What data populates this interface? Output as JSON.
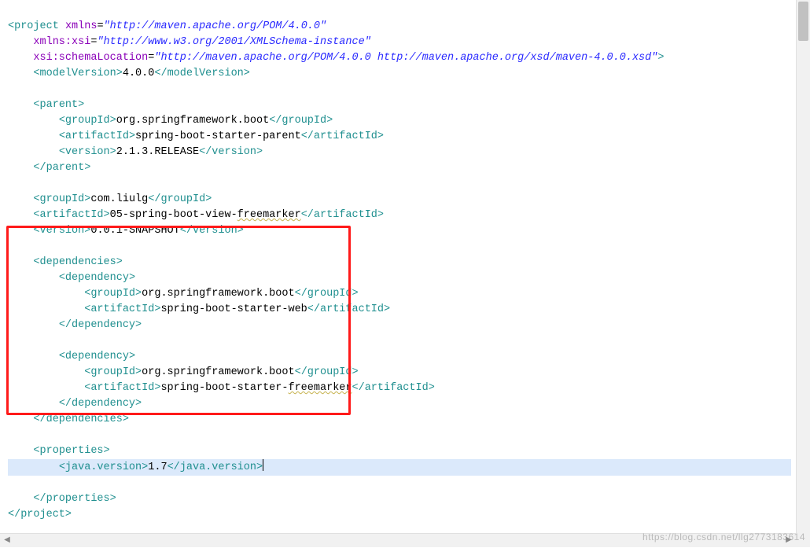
{
  "xml": {
    "project_open": "project",
    "project_close": "project",
    "xmlns_attr": "xmlns",
    "xmlns_val": "\"http://maven.apache.org/POM/4.0.0\"",
    "xmlns_xsi_attr": "xmlns:xsi",
    "xmlns_xsi_val": "\"http://www.w3.org/2001/XMLSchema-instance\"",
    "xsi_schema_attr": "xsi:schemaLocation",
    "xsi_schema_val": "\"http://maven.apache.org/POM/4.0.0 http://maven.apache.org/xsd/maven-4.0.0.xsd\"",
    "modelVersion_tag": "modelVersion",
    "modelVersion_val": "4.0.0",
    "parent_tag": "parent",
    "groupId_tag": "groupId",
    "artifactId_tag": "artifactId",
    "version_tag": "version",
    "parent_groupId": "org.springframework.boot",
    "parent_artifactId": "spring-boot-starter-parent",
    "parent_version": "2.1.3.RELEASE",
    "proj_groupId": "com.liulg",
    "proj_artifactId_pre": "05-spring-boot-view-",
    "proj_artifactId_sq": "freemarker",
    "proj_version": "0.0.1-SNAPSHOT",
    "dependencies_tag": "dependencies",
    "dependency_tag": "dependency",
    "dep1_groupId": "org.springframework.boot",
    "dep1_artifactId": "spring-boot-starter-web",
    "dep2_groupId": "org.springframework.boot",
    "dep2_artifactId_pre": "spring-boot-starter-",
    "dep2_artifactId_sq": "freemarker",
    "properties_tag": "properties",
    "java_version_tag": "java.version",
    "java_version_val": "1.7"
  },
  "watermark": "https://blog.csdn.net/llg2773183614"
}
